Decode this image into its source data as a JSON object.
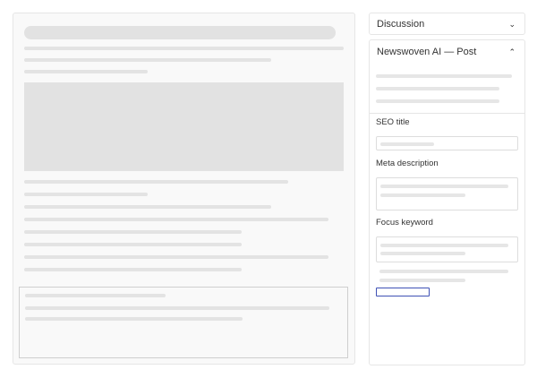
{
  "sidebar": {
    "discussion": {
      "label": "Discussion"
    },
    "newswoven": {
      "label": "Newswoven AI — Post",
      "fields": {
        "seo_title": "SEO title",
        "meta_description": "Meta description",
        "focus_keyword": "Focus keyword"
      }
    }
  },
  "icons": {
    "discussion_toggle": "chevron-down-icon",
    "newswoven_toggle": "chevron-up-icon"
  },
  "colors": {
    "accent": "#3f51b5",
    "skeleton": "#e3e3e3",
    "border": "#e6e6e6"
  }
}
